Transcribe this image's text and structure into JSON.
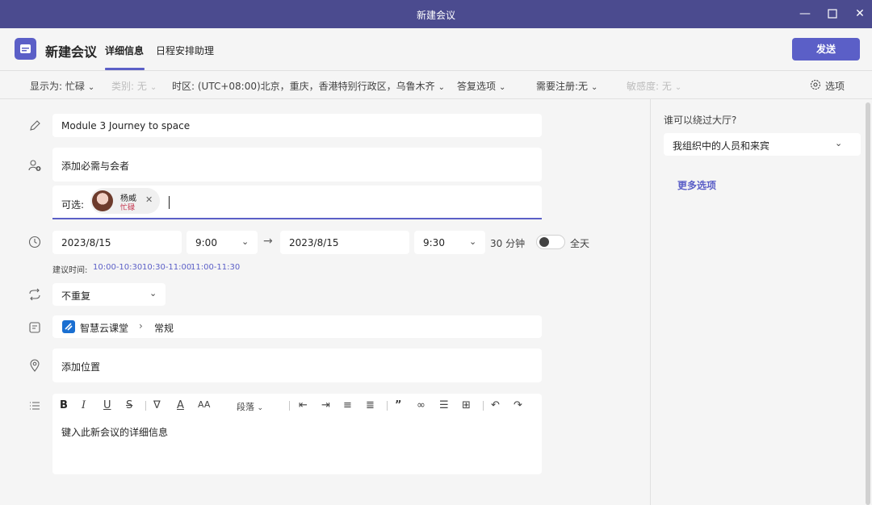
{
  "window": {
    "title": "新建会议"
  },
  "header": {
    "title": "新建会议",
    "tabs": [
      {
        "label": "详细信息"
      },
      {
        "label": "日程安排助理"
      }
    ],
    "send_label": "发送"
  },
  "options_bar": {
    "show_as": "显示为: 忙碌",
    "category": "类别: 无",
    "timezone": "时区: (UTC+08:00)北京，重庆，香港特别行政区，乌鲁木齐",
    "response": "答复选项",
    "registration": "需要注册:无",
    "sensitivity": "敏感度: 无",
    "options_label": "选项"
  },
  "form": {
    "title_value": "Module 3 Journey to space",
    "required_placeholder": "添加必需与会者",
    "optional_label": "可选:",
    "attendee": {
      "name": "杨威",
      "status": "忙碌"
    },
    "start_date": "2023/8/15",
    "start_time": "9:00",
    "end_date": "2023/8/15",
    "end_time": "9:30",
    "duration": "30 分钟",
    "all_day_label": "全天",
    "suggest_label": "建议时间:",
    "suggestions": [
      "10:00-10:30",
      "10:30-11:00",
      "11:00-11:30"
    ],
    "repeat_value": "不重复",
    "channel": {
      "team": "智慧云课堂",
      "channel": "常规"
    },
    "location_placeholder": "添加位置",
    "editor": {
      "paragraph_label": "段落",
      "placeholder": "键入此新会议的详细信息"
    }
  },
  "sidebar": {
    "lobby_label": "谁可以绕过大厅?",
    "lobby_value": "我组织中的人员和来宾",
    "more_options": "更多选项"
  },
  "colors": {
    "accent": "#5b5fc7",
    "titlebar": "#4b4b8f",
    "busy": "#c4314b"
  }
}
